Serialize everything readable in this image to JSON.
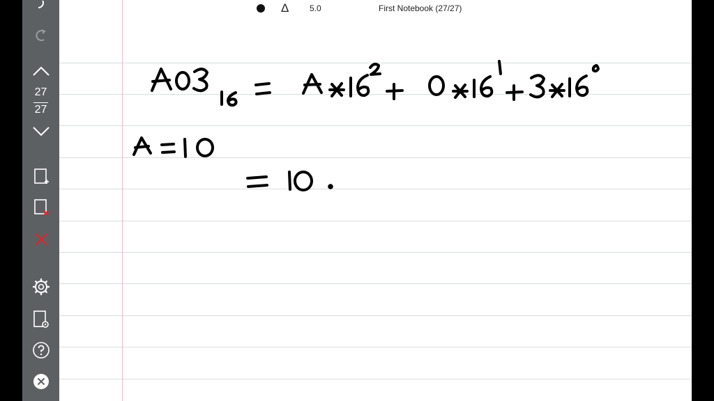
{
  "toolbar": {
    "zoom": "5.0",
    "title": "First Notebook (27/27)",
    "pen_icon": "delta-pen-icon",
    "record_icon": "black-dot-icon"
  },
  "sidebar": {
    "current_page": "27",
    "total_pages": "27",
    "icons": [
      "undo-icon",
      "redo-icon",
      "page-up-icon",
      "page-down-icon",
      "add-page-icon",
      "delete-page-icon",
      "clear-icon",
      "settings-icon",
      "page-settings-icon",
      "help-icon",
      "close-icon"
    ]
  },
  "colors": {
    "sidebar": "#5d6063",
    "paper": "#ffffff",
    "rule_line": "#d8dcdf",
    "margin_line": "#f0b8d0",
    "delete_accent": "#e0242c",
    "ink": "#000000"
  }
}
